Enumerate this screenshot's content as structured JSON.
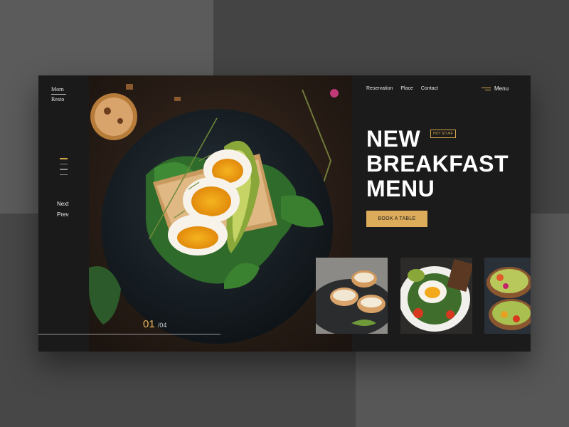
{
  "brand": {
    "line1": "Morn",
    "line2": "Resto"
  },
  "sidebar": {
    "next_label": "Next",
    "prev_label": "Prev"
  },
  "slider": {
    "current": "01",
    "separator": "/",
    "total": "04"
  },
  "topnav": {
    "items": [
      "Reservation",
      "Place",
      "Contact"
    ],
    "menu_label": "Menu"
  },
  "hero": {
    "headline_line1": "NEW",
    "headline_line2": "BREAKFAST",
    "headline_line3": "MENU",
    "badge": "HOT STUFF"
  },
  "cta": {
    "label": "BOOK A TABLE"
  },
  "colors": {
    "accent": "#dcac5b",
    "panel": "#1b1b1b",
    "background": "#4d4d4d"
  }
}
